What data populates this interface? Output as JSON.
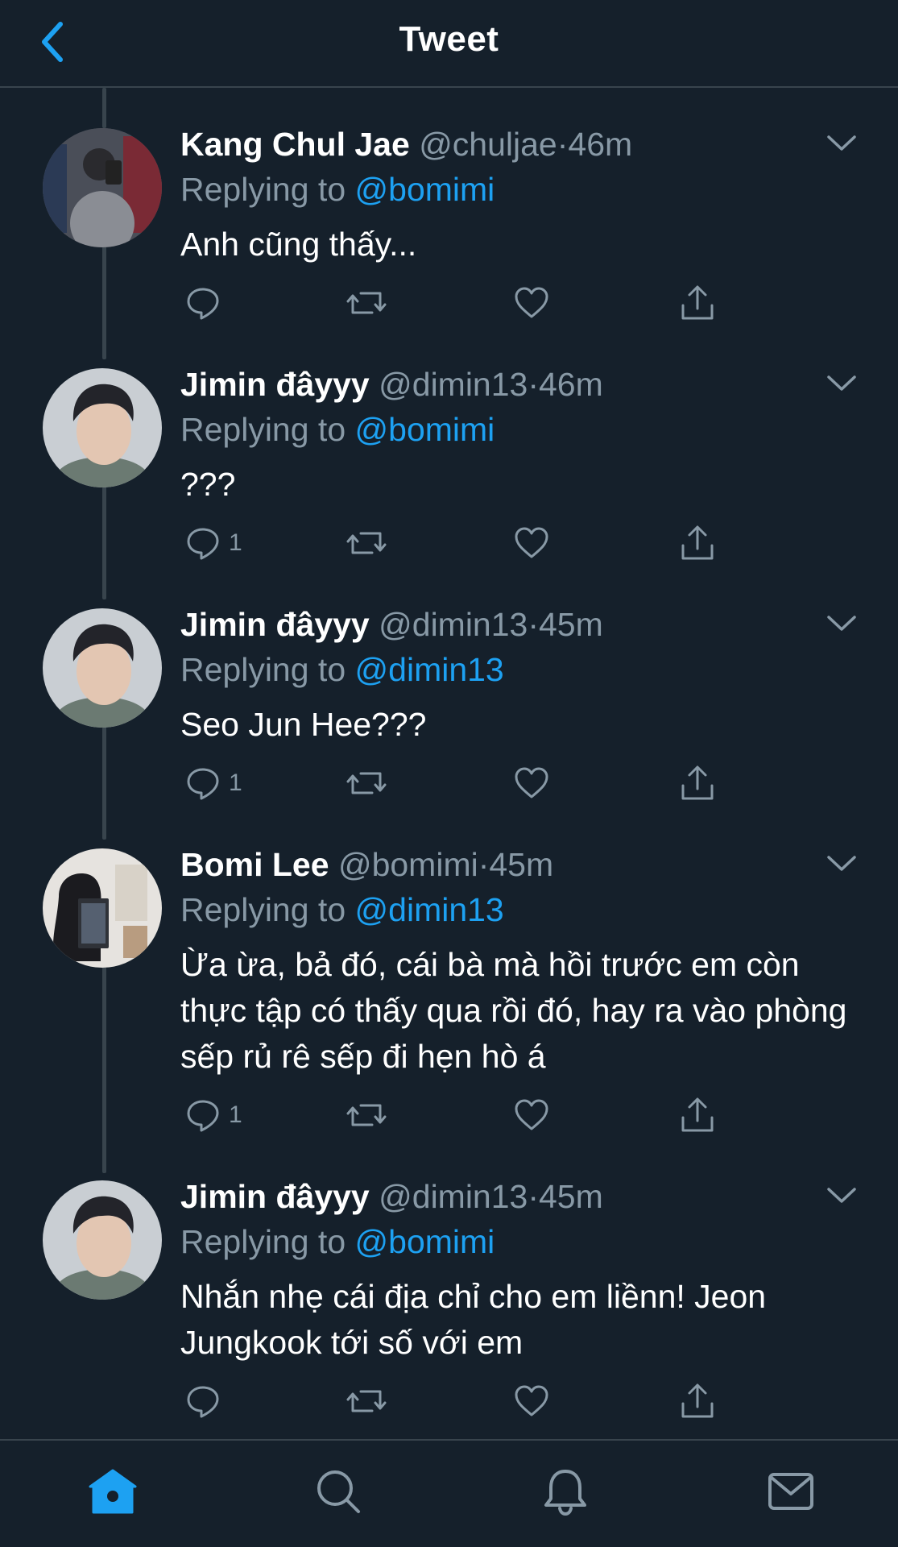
{
  "header": {
    "title": "Tweet",
    "back_icon": "chevron-left-icon"
  },
  "colors": {
    "background": "#15202b",
    "accent": "#1da1f2",
    "muted": "#8899a6",
    "divider": "#38444d"
  },
  "tweets": [
    {
      "name": "Kang Chul Jae",
      "handle": "@chuljae",
      "dot": "·",
      "time": "46m",
      "replying_prefix": "Replying to",
      "replying_to": "@bomimi",
      "text": "Anh cũng thấy...",
      "reply_count": "",
      "avatar": "avatar-kang-chul-jae"
    },
    {
      "name": "Jimin đâyyy",
      "handle": "@dimin13",
      "dot": "·",
      "time": "46m",
      "replying_prefix": "Replying to",
      "replying_to": "@bomimi",
      "text": "???",
      "reply_count": "1",
      "avatar": "avatar-jimin"
    },
    {
      "name": "Jimin đâyyy",
      "handle": "@dimin13",
      "dot": "·",
      "time": "45m",
      "replying_prefix": "Replying to",
      "replying_to": "@dimin13",
      "text": "Seo Jun Hee???",
      "reply_count": "1",
      "avatar": "avatar-jimin"
    },
    {
      "name": "Bomi Lee",
      "handle": "@bomimi",
      "dot": "·",
      "time": "45m",
      "replying_prefix": "Replying to",
      "replying_to": "@dimin13",
      "text": "Ừa ừa, bả đó, cái bà mà hồi trước em còn thực tập có thấy qua rồi đó, hay ra vào phòng sếp rủ rê sếp đi hẹn hò á",
      "reply_count": "1",
      "avatar": "avatar-bomi-lee"
    },
    {
      "name": "Jimin đâyyy",
      "handle": "@dimin13",
      "dot": "·",
      "time": "45m",
      "replying_prefix": "Replying to",
      "replying_to": "@bomimi",
      "text": "Nhắn nhẹ cái địa chỉ cho em liềnn! Jeon Jungkook tới số với em",
      "reply_count": "",
      "avatar": "avatar-jimin"
    }
  ],
  "tabbar": {
    "icons": [
      "home-icon",
      "search-icon",
      "notifications-icon",
      "messages-icon"
    ]
  }
}
